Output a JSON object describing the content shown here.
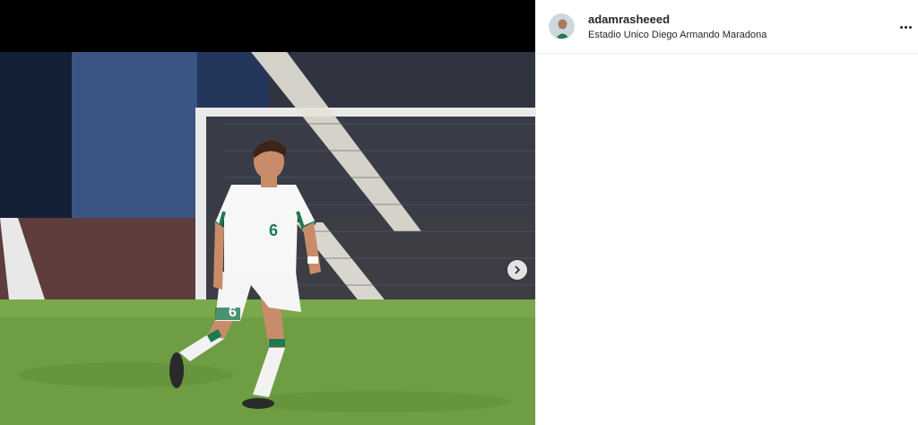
{
  "post": {
    "username": "adamrasheeed",
    "separator": "·",
    "location": "Estadio Unico Diego Armando Maradona"
  },
  "photo": {
    "jersey_number": "6",
    "jersey_color": "#ffffff",
    "trim_color": "#1f7a4f"
  },
  "icons": {
    "next": "chevron-right-icon",
    "more": "more-options-icon"
  },
  "colors": {
    "background": "#ffffff",
    "media_background": "#000000",
    "text": "#262626",
    "muted": "#8e8e8e",
    "divider": "#efefef"
  }
}
